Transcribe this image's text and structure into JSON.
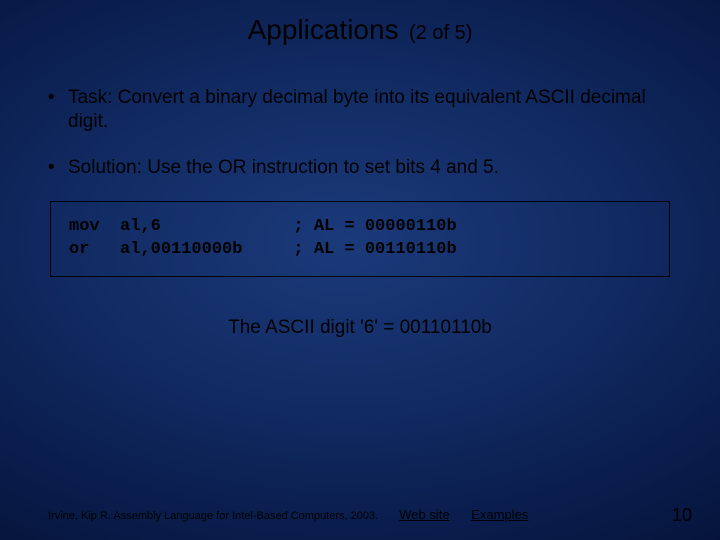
{
  "title": {
    "main": "Applications",
    "sub": "(2 of 5)"
  },
  "bullets": [
    "Task: Convert a binary decimal byte into its equivalent ASCII decimal digit.",
    "Solution: Use the OR instruction to set bits 4 and 5."
  ],
  "code": "mov  al,6             ; AL = 00000110b\nor   al,00110000b     ; AL = 00110110b",
  "caption": "The ASCII digit '6' = 00110110b",
  "footer": {
    "citation": "Irvine, Kip R. Assembly Language for Intel-Based Computers, 2003.",
    "link1": "Web site",
    "link2": "Examples"
  },
  "page_number": "10"
}
